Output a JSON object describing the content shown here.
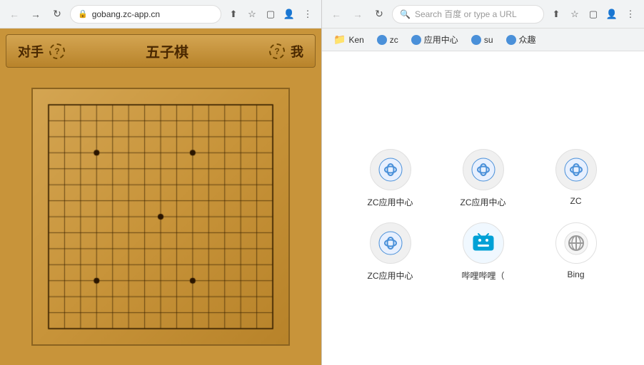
{
  "left_browser": {
    "url": "gobang.zc-app.cn",
    "nav": {
      "back_label": "←",
      "forward_label": "→",
      "refresh_label": "↻",
      "more_label": "⋮"
    },
    "game": {
      "opponent_label": "对手",
      "help_label": "?",
      "title": "五子棋",
      "my_label": "我",
      "board_size": 15,
      "dots": [
        {
          "row": 3,
          "col": 3
        },
        {
          "row": 3,
          "col": 9
        },
        {
          "row": 7,
          "col": 7
        },
        {
          "row": 11,
          "col": 3
        },
        {
          "row": 11,
          "col": 9
        }
      ]
    }
  },
  "right_browser": {
    "nav": {
      "back_label": "←",
      "forward_label": "→",
      "refresh_label": "↻",
      "more_label": "⋮"
    },
    "search_placeholder": "Search 百度 or type a URL",
    "bookmarks": [
      {
        "label": "Ken",
        "type": "folder"
      },
      {
        "label": "zc",
        "type": "icon"
      },
      {
        "label": "应用中心",
        "type": "icon"
      },
      {
        "label": "su",
        "type": "icon"
      },
      {
        "label": "众趣",
        "type": "icon"
      }
    ],
    "shortcuts": [
      {
        "label": "ZC应用中心",
        "type": "zc"
      },
      {
        "label": "ZC应用中心",
        "type": "zc"
      },
      {
        "label": "ZC",
        "type": "zc"
      },
      {
        "label": "ZC应用中心",
        "type": "zc"
      },
      {
        "label": "哔哩哔哩（",
        "type": "bilibili"
      },
      {
        "label": "Bing",
        "type": "bing"
      }
    ]
  }
}
